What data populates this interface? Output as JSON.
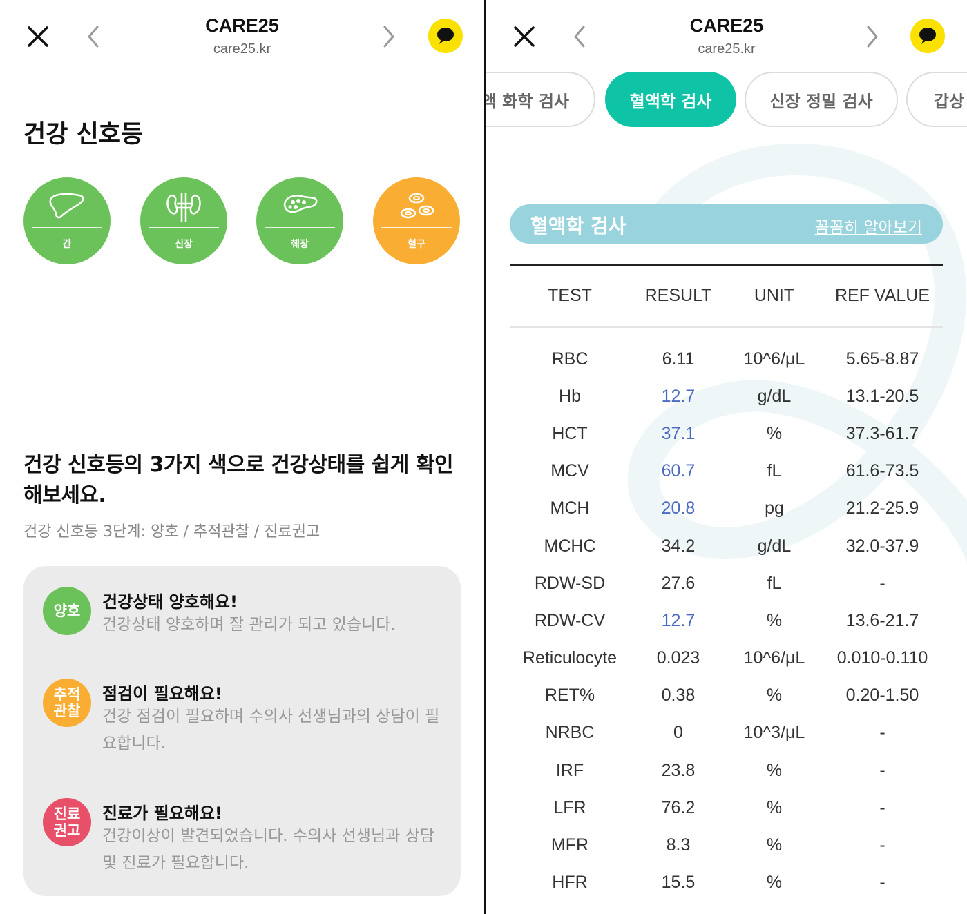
{
  "header": {
    "title": "CARE25",
    "subtitle": "care25.kr"
  },
  "left": {
    "section_title": "건강 신호등",
    "organs": [
      {
        "label": "간",
        "color": "#6cc25a",
        "icon": "liver-icon"
      },
      {
        "label": "신장",
        "color": "#6cc25a",
        "icon": "kidney-icon"
      },
      {
        "label": "췌장",
        "color": "#6cc25a",
        "icon": "pancreas-icon"
      },
      {
        "label": "혈구",
        "color": "#f9ae33",
        "icon": "blood-cell-icon"
      }
    ],
    "headline": "건강 신호등의 3가지 색으로 건강상태를 쉽게 확인해보세요.",
    "steps_text": "건강 신호등 3단계: 양호 / 추적관찰 / 진료권고",
    "legend": [
      {
        "badge": "양호",
        "color": "#6cc25a",
        "title": "건강상태 양호해요!",
        "desc": "건강상태 양호하며 잘 관리가 되고 있습니다."
      },
      {
        "badge": "추적관찰",
        "badge_line1": "추적",
        "badge_line2": "관찰",
        "color": "#f9ae33",
        "title": "점검이 필요해요!",
        "desc": "건강 점검이 필요하며 수의사 선생님과의 상담이 필요합니다."
      },
      {
        "badge": "진료권고",
        "badge_line1": "진료",
        "badge_line2": "권고",
        "color": "#e8506a",
        "title": "진료가 필요해요!",
        "desc": "건강이상이 발견되었습니다. 수의사 선생님과 상담 및 진료가 필요합니다."
      }
    ]
  },
  "right": {
    "tabs": [
      {
        "label": "액 화학 검사",
        "active": false
      },
      {
        "label": "혈액학 검사",
        "active": true
      },
      {
        "label": "신장 정밀 검사",
        "active": false
      },
      {
        "label": "갑상",
        "active": false
      }
    ],
    "banner": {
      "title": "혈액학 검사",
      "link": "꼼꼼히 알아보기"
    },
    "table": {
      "headers": [
        "TEST",
        "RESULT",
        "UNIT",
        "REF VALUE"
      ],
      "rows": [
        {
          "test": "RBC",
          "result": "6.11",
          "unit": "10^6/μL",
          "ref": "5.65-8.87",
          "low": false
        },
        {
          "test": "Hb",
          "result": "12.7",
          "unit": "g/dL",
          "ref": "13.1-20.5",
          "low": true
        },
        {
          "test": "HCT",
          "result": "37.1",
          "unit": "%",
          "ref": "37.3-61.7",
          "low": true
        },
        {
          "test": "MCV",
          "result": "60.7",
          "unit": "fL",
          "ref": "61.6-73.5",
          "low": true
        },
        {
          "test": "MCH",
          "result": "20.8",
          "unit": "pg",
          "ref": "21.2-25.9",
          "low": true
        },
        {
          "test": "MCHC",
          "result": "34.2",
          "unit": "g/dL",
          "ref": "32.0-37.9",
          "low": false
        },
        {
          "test": "RDW-SD",
          "result": "27.6",
          "unit": "fL",
          "ref": "-",
          "low": false
        },
        {
          "test": "RDW-CV",
          "result": "12.7",
          "unit": "%",
          "ref": "13.6-21.7",
          "low": true
        },
        {
          "test": "Reticulocyte",
          "result": "0.023",
          "unit": "10^6/μL",
          "ref": "0.010-0.110",
          "low": false
        },
        {
          "test": "RET%",
          "result": "0.38",
          "unit": "%",
          "ref": "0.20-1.50",
          "low": false
        },
        {
          "test": "NRBC",
          "result": "0",
          "unit": "10^3/μL",
          "ref": "-",
          "low": false
        },
        {
          "test": "IRF",
          "result": "23.8",
          "unit": "%",
          "ref": "-",
          "low": false
        },
        {
          "test": "LFR",
          "result": "76.2",
          "unit": "%",
          "ref": "-",
          "low": false
        },
        {
          "test": "MFR",
          "result": "8.3",
          "unit": "%",
          "ref": "-",
          "low": false
        },
        {
          "test": "HFR",
          "result": "15.5",
          "unit": "%",
          "ref": "-",
          "low": false
        }
      ]
    }
  },
  "colors": {
    "accent_teal": "#0fc3a6",
    "banner_blue": "#98d3de",
    "good_green": "#6cc25a",
    "watch_orange": "#f9ae33",
    "alert_red": "#e8506a",
    "low_value_blue": "#4a6bbf",
    "kakao_yellow": "#fae100"
  }
}
